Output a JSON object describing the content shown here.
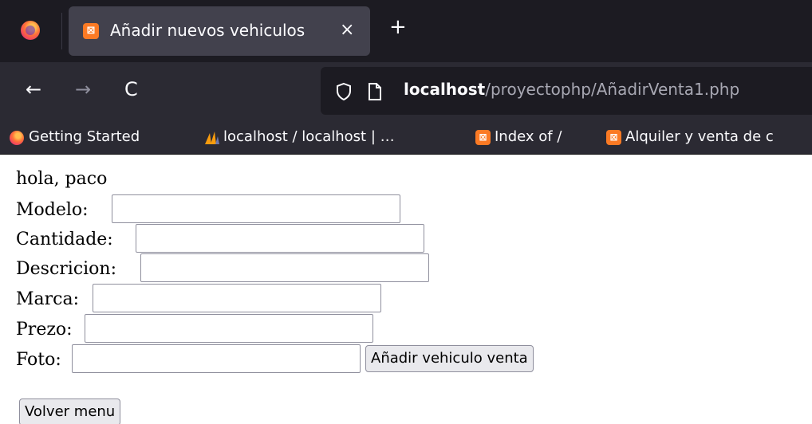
{
  "browser": {
    "tab_title": "Añadir nuevos vehiculos",
    "tab_close": "×",
    "new_tab": "+",
    "tab_favicon": "⊠",
    "url_host": "localhost",
    "url_path": "/proyectophp/AñadirVenta1.php",
    "nav": {
      "back": "←",
      "forward": "→",
      "reload": "C"
    },
    "bookmarks": [
      {
        "label": "Getting Started",
        "icon": "firefox-icon"
      },
      {
        "label": "localhost / localhost | …",
        "icon": "phpmyadmin-icon"
      },
      {
        "label": "Index of /",
        "icon": "xampp-icon"
      },
      {
        "label": "Alquiler y venta de c",
        "icon": "xampp-icon"
      }
    ],
    "colors": {
      "tab_strip": "#1c1b22",
      "toolbar": "#2b2a33",
      "active_tab": "#42414d",
      "xampp": "#fb7a24"
    }
  },
  "page": {
    "greeting": "hola, paco",
    "fields": [
      {
        "label": "Modelo: ",
        "value": ""
      },
      {
        "label": "Cantidade:",
        "value": ""
      },
      {
        "label": "Descricion:",
        "value": ""
      },
      {
        "label": "Marca:",
        "value": ""
      },
      {
        "label": "Prezo:",
        "value": ""
      },
      {
        "label": "Foto:",
        "value": ""
      }
    ],
    "submit_label": "Añadir vehiculo venta",
    "back_label": "Volver menu"
  }
}
